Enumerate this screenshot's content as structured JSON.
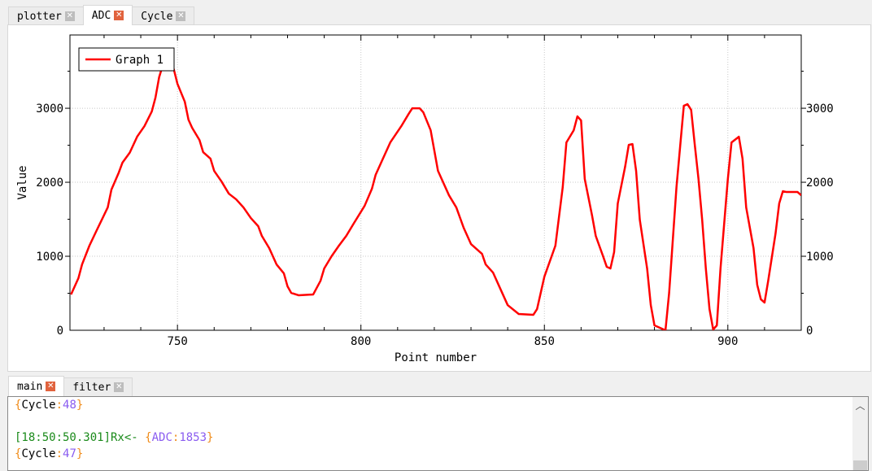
{
  "top_tabs": [
    {
      "label": "plotter",
      "active": false
    },
    {
      "label": "ADC",
      "active": true
    },
    {
      "label": "Cycle",
      "active": false
    }
  ],
  "bottom_tabs": [
    {
      "label": "main",
      "active": true
    },
    {
      "label": "filter",
      "active": false
    }
  ],
  "chart_data": {
    "type": "line",
    "xlabel": "Point number",
    "ylabel": "Value",
    "xlim": [
      720.7,
      920
    ],
    "ylim": [
      0,
      3990
    ],
    "xticks": [
      750,
      800,
      850,
      900
    ],
    "yticks": [
      0,
      1000,
      2000,
      3000
    ],
    "grid": true,
    "legend_placement": "top-left",
    "series": [
      {
        "name": "Graph 1",
        "color": "#ff0000",
        "x": [
          721,
          723,
          724,
          726,
          728,
          731,
          732,
          734,
          735,
          737,
          739,
          741,
          743,
          744,
          745,
          746,
          747,
          749,
          750,
          752,
          753,
          754,
          756,
          757,
          759,
          760,
          762,
          764,
          766,
          768,
          770,
          772,
          773,
          775,
          777,
          779,
          780,
          781,
          783,
          787,
          789,
          790,
          792,
          794,
          796,
          798,
          801,
          803,
          804,
          806,
          808,
          811,
          813,
          814,
          816,
          817,
          819,
          820,
          821,
          824,
          826,
          828,
          830,
          833,
          834,
          836,
          838,
          840,
          843,
          847,
          848,
          850,
          853,
          855,
          856,
          858,
          859,
          860,
          861,
          863,
          864,
          866,
          867,
          868,
          869,
          870,
          872,
          873,
          874,
          875,
          876,
          878,
          879,
          880,
          883,
          884,
          885,
          886,
          887,
          888,
          889,
          890,
          891,
          892,
          893,
          894,
          895,
          896,
          897,
          898,
          899,
          900,
          901,
          903,
          904,
          905,
          907,
          908,
          909,
          910,
          911,
          913,
          914,
          915,
          916,
          919,
          920
        ],
        "y": [
          484,
          703,
          890,
          1143,
          1352,
          1660,
          1900,
          2130,
          2264,
          2400,
          2615,
          2758,
          2956,
          3143,
          3418,
          3582,
          3560,
          3527,
          3330,
          3088,
          2846,
          2736,
          2571,
          2407,
          2318,
          2154,
          2011,
          1846,
          1769,
          1659,
          1516,
          1407,
          1275,
          1110,
          890,
          769,
          593,
          505,
          473,
          484,
          670,
          835,
          1000,
          1143,
          1275,
          1440,
          1681,
          1912,
          2099,
          2319,
          2538,
          2758,
          2923,
          3000,
          3000,
          2945,
          2703,
          2429,
          2154,
          1824,
          1659,
          1385,
          1165,
          1033,
          890,
          780,
          560,
          340,
          220,
          209,
          286,
          725,
          1143,
          1934,
          2538,
          2703,
          2890,
          2835,
          2044,
          1549,
          1275,
          1000,
          857,
          835,
          1055,
          1714,
          2209,
          2505,
          2516,
          2154,
          1494,
          835,
          340,
          66,
          0,
          505,
          1220,
          1934,
          2484,
          3033,
          3055,
          2978,
          2500,
          2044,
          1494,
          835,
          286,
          11,
          66,
          835,
          1440,
          2044,
          2538,
          2615,
          2319,
          1659,
          1110,
          615,
          418,
          374,
          670,
          1308,
          1714,
          1879,
          1868,
          1868,
          1824
        ]
      }
    ]
  },
  "console": {
    "lines": [
      [
        {
          "t": "{",
          "c": "b"
        },
        {
          "t": "Cycle",
          "c": "k"
        },
        {
          "t": ":",
          "c": "b"
        },
        {
          "t": "48",
          "c": "v"
        },
        {
          "t": "}",
          "c": "b"
        }
      ],
      [],
      [
        {
          "t": "[18:50:50.301]Rx<- ",
          "c": "g"
        },
        {
          "t": "{",
          "c": "b"
        },
        {
          "t": "ADC",
          "c": "v"
        },
        {
          "t": ":",
          "c": "b"
        },
        {
          "t": "1853",
          "c": "v"
        },
        {
          "t": "}",
          "c": "b"
        }
      ],
      [
        {
          "t": "{",
          "c": "b"
        },
        {
          "t": "Cycle",
          "c": "k"
        },
        {
          "t": ":",
          "c": "b"
        },
        {
          "t": "47",
          "c": "v"
        },
        {
          "t": "}",
          "c": "b"
        }
      ]
    ]
  }
}
